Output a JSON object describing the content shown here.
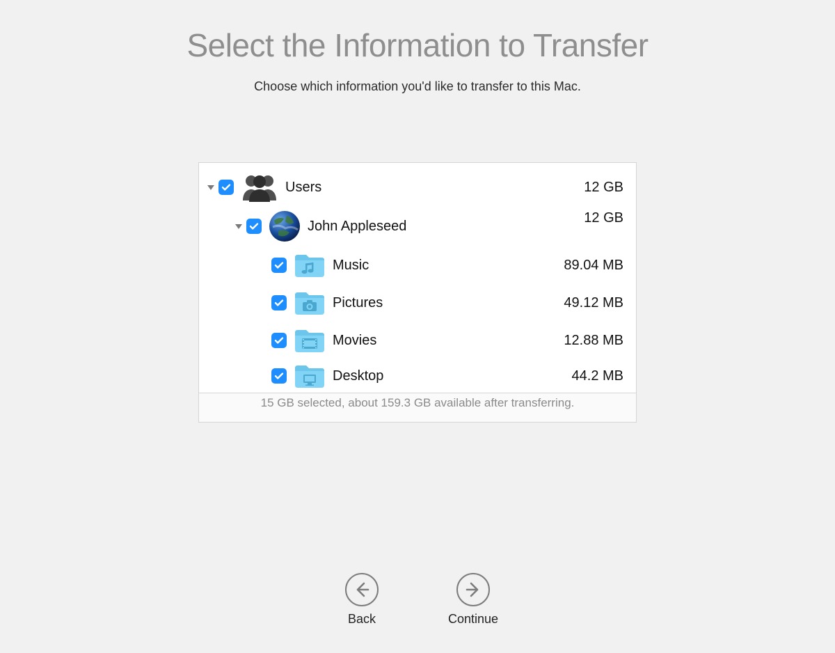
{
  "header": {
    "title": "Select the Information to Transfer",
    "subtitle": "Choose which information you'd like to transfer to this Mac."
  },
  "tree": {
    "users": {
      "label": "Users",
      "size": "12 GB",
      "checked": true,
      "expanded": true,
      "user": {
        "name": "John Appleseed",
        "size": "12 GB",
        "checked": true,
        "expanded": true,
        "folders": [
          {
            "icon": "music",
            "label": "Music",
            "size": "89.04 MB",
            "checked": true
          },
          {
            "icon": "pictures",
            "label": "Pictures",
            "size": "49.12 MB",
            "checked": true
          },
          {
            "icon": "movies",
            "label": "Movies",
            "size": "12.88 MB",
            "checked": true
          },
          {
            "icon": "desktop",
            "label": "Desktop",
            "size": "44.2 MB",
            "checked": true
          }
        ]
      }
    }
  },
  "status": "15 GB selected, about 159.3 GB available after transferring.",
  "nav": {
    "back": "Back",
    "continue": "Continue"
  }
}
